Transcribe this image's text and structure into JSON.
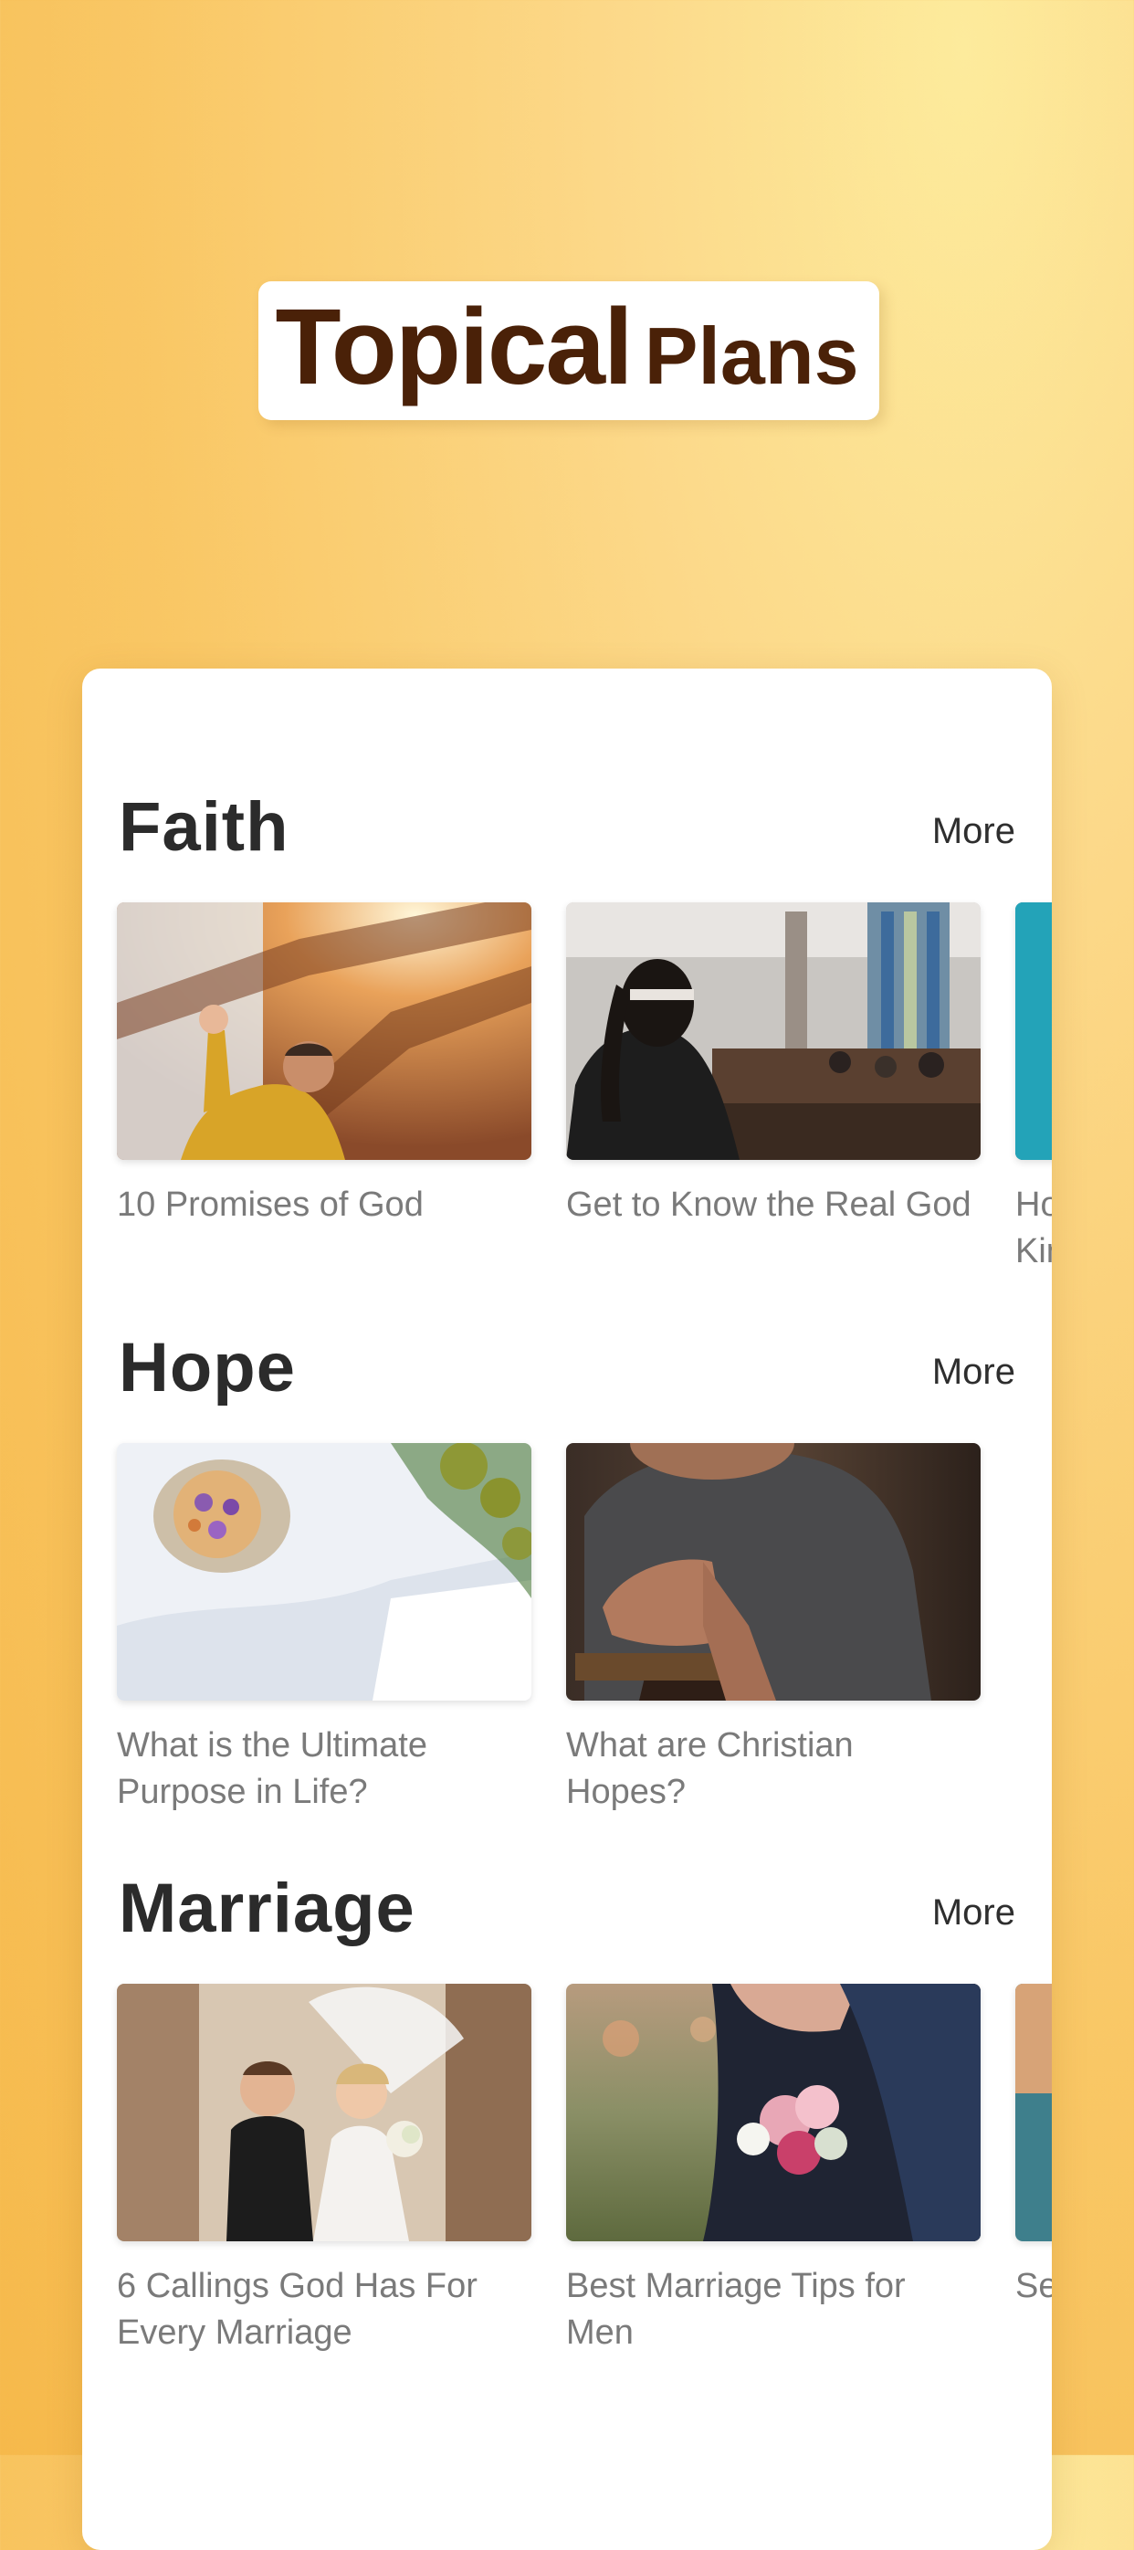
{
  "hero": {
    "title_bold": "Topical",
    "title_light": "Plans"
  },
  "sections": [
    {
      "title": "Faith",
      "more": "More",
      "items": [
        {
          "label": "10 Promises of God"
        },
        {
          "label": "Get to Know the Real God"
        },
        {
          "label": "Ho Kin"
        }
      ]
    },
    {
      "title": "Hope",
      "more": "More",
      "items": [
        {
          "label": "What is the Ultimate Purpose in Life?"
        },
        {
          "label": "What are Christian Hopes?"
        }
      ]
    },
    {
      "title": "Marriage",
      "more": "More",
      "items": [
        {
          "label": "6 Callings God Has For Every Marriage"
        },
        {
          "label": "Best Marriage Tips for Men"
        },
        {
          "label": "Se"
        }
      ]
    }
  ],
  "colors": {
    "title_brown": "#4a2108",
    "bg_top": "#fdeb9c",
    "bg_bottom": "#f6b94b"
  }
}
